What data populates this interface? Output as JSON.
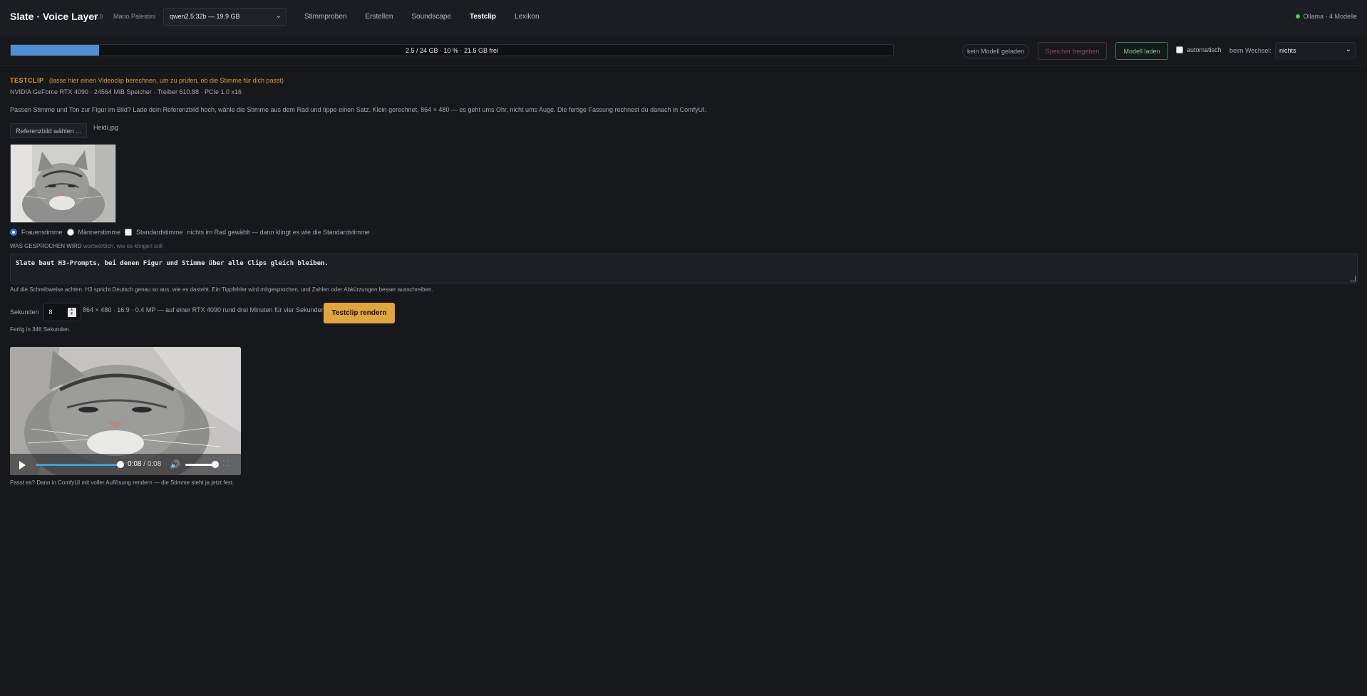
{
  "app": {
    "title": "Slate · Voice Layer",
    "version": "v1.0",
    "author": "Mario Palestini",
    "model_select": "qwen2.5:32b — 19.9 GB",
    "tabs": [
      "Stimmproben",
      "Erstellen",
      "Soundscape",
      "Testclip",
      "Lexikon"
    ],
    "active_tab": "Testclip",
    "ollama_status": "Ollama · 4 Modelle"
  },
  "vram": {
    "usage_text": "2.5 / 24 GB · 10 % · 21.5 GB frei",
    "used_fraction": 0.1,
    "loaded_pill": "kein Modell geladen",
    "free_button": "Speicher freigeben",
    "load_button": "Modell laden",
    "auto_label": "automatisch",
    "switch_label": "beim Wechsel:",
    "switch_value": "nichts"
  },
  "testclip": {
    "title": "TESTCLIP",
    "subtitle": "(lasse hier einen Videoclip berechnen, um zu prüfen, ob die Stimme für dich passt)",
    "gpu_info": "NVIDIA GeForce RTX 4090 · 24564 MiB Speicher · Treiber 610.88 · PCIe 1.0 x16",
    "intro": "Passen Stimme und Ton zur Figur im Bild? Lade dein Referenzbild hoch, wähle die Stimme aus dem Rad und tippe einen Satz. Klein gerechnet, 864 × 480 — es geht ums Ohr, nicht ums Auge. Die fertige Fassung rechnest du danach in ComfyUI.",
    "ref_button": "Referenzbild wählen ...",
    "ref_file": "Heidi.jpg",
    "voice_female": "Frauenstimme",
    "voice_male": "Männerstimme",
    "voice_standard": "Standardstimme",
    "voice_hint": "nichts im Rad gewählt — dann klingt es wie die Standardstimme",
    "spoken_label": "WAS GESPROCHEN WIRD",
    "spoken_hint": "wortwörtlich, wie es klingen soll",
    "spoken_text": "Slate baut H3-Prompts, bei denen Figur und Stimme über alle Clips gleich bleiben.",
    "spelling_note": "Auf die Schreibweise achten: H3 spricht Deutsch genau so aus, wie es dasteht. Ein Tippfehler wird mitgesprochen, und Zahlen oder Abkürzungen besser ausschreiben.",
    "seconds_label": "Sekunden",
    "seconds_value": "8",
    "spec": "864 × 480 · 16:9 · 0.4 MP — auf einer RTX 4090 rund drei Minuten für vier Sekunden",
    "render_button": "Testclip rendern",
    "done_text": "Fertig in 346 Sekunden.",
    "time_current": "0:08",
    "time_sep": " / ",
    "time_total": "0:08",
    "progress_fraction": 1.0,
    "final_note": "Passt es? Dann in ComfyUI mit voller Auflösung rendern — die Stimme steht ja jetzt fest."
  },
  "colors": {
    "background": "#17181c",
    "accent_orange": "#e0a53f",
    "accent_blue": "#4f8fd6",
    "accent_green": "#7fd08f",
    "danger": "#8e4c56"
  },
  "icons": [
    "chevron-down-icon",
    "status-dot-icon",
    "play-icon",
    "volume-icon",
    "fullscreen-icon",
    "spin-icon"
  ]
}
